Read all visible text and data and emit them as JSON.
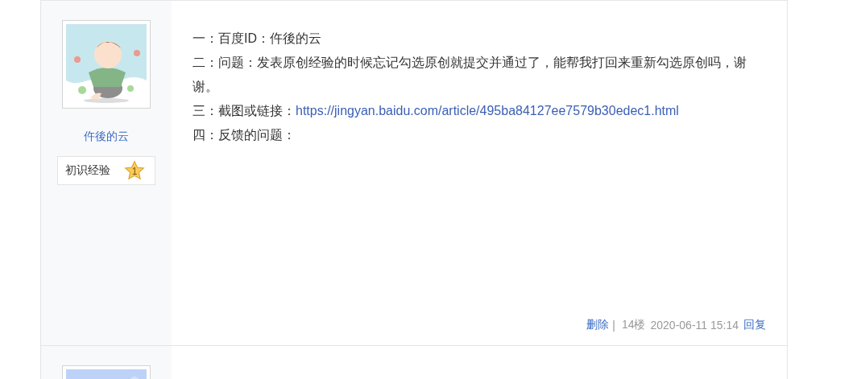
{
  "posts": [
    {
      "author": {
        "name": "仵後的云",
        "avatar": {
          "kind": "picture"
        },
        "badge": {
          "label": "初识经验",
          "level": "1"
        }
      },
      "lines": [
        {
          "kind": "text",
          "text": "一：百度ID：仵後的云"
        },
        {
          "kind": "text",
          "text": "二：问题：发表原创经验的时候忘记勾选原创就提交并通过了，能帮我打回来重新勾选原创吗，谢谢。"
        },
        {
          "kind": "link",
          "label": "三：截图或链接：",
          "url": "https://jingyan.baidu.com/article/495ba84127ee7579b30edec1.html"
        },
        {
          "kind": "text",
          "text": "四：反馈的问题："
        }
      ],
      "footer": {
        "delete": "删除",
        "separator": "|",
        "floor": "14楼",
        "time": "2020-06-11 15:14",
        "reply": "回复"
      }
    },
    {
      "author": {
        "avatar": {
          "kind": "picture"
        }
      }
    }
  ]
}
